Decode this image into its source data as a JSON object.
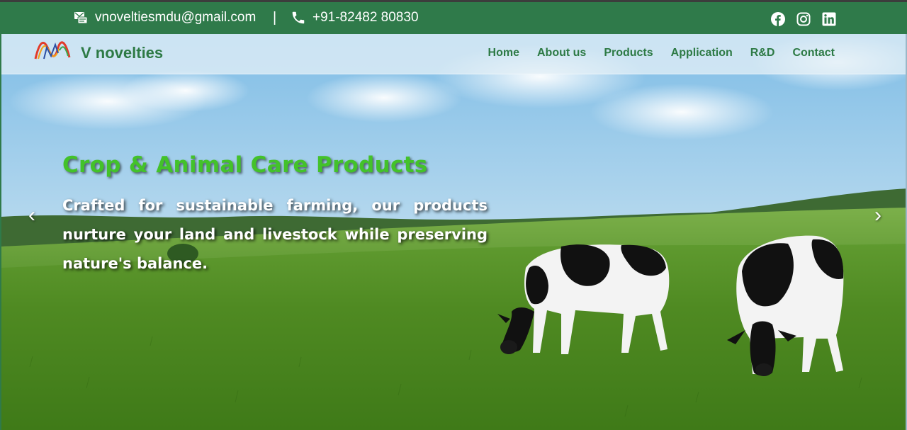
{
  "topbar": {
    "email": "vnoveltiesmdu@gmail.com",
    "separator": "|",
    "phone": "+91-82482 80830",
    "socials": [
      "facebook-icon",
      "instagram-icon",
      "linkedin-icon"
    ]
  },
  "brand": {
    "name": "V novelties",
    "logo": "wave-logo"
  },
  "nav": {
    "items": [
      "Home",
      "About us",
      "Products",
      "Application",
      "R&D",
      "Contact"
    ]
  },
  "hero": {
    "title": "Crop & Animal Care Products",
    "text": "Crafted for sustainable farming, our products nurture your land and livestock while preserving nature's balance.",
    "prev": "‹",
    "next": "›"
  },
  "colors": {
    "brand_green": "#2f7a4a",
    "title_green": "#43c22a",
    "nav_text": "#2d7a45"
  }
}
